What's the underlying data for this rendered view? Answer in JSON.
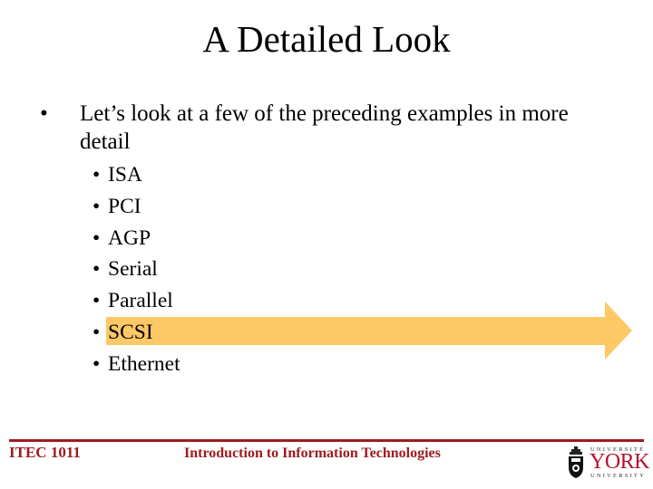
{
  "slide": {
    "title": "A Detailed Look",
    "main_bullet": {
      "glyph": "•",
      "text": "Let’s look at a few of the preceding examples in more detail"
    },
    "sub_bullets": [
      {
        "glyph": "•",
        "text": "ISA"
      },
      {
        "glyph": "•",
        "text": "PCI"
      },
      {
        "glyph": "•",
        "text": "AGP"
      },
      {
        "glyph": "•",
        "text": "Serial"
      },
      {
        "glyph": "•",
        "text": "Parallel"
      },
      {
        "glyph": "•",
        "text": "SCSI",
        "highlighted": true
      },
      {
        "glyph": "•",
        "text": "Ethernet"
      }
    ],
    "highlight_arrow": {
      "icon": "right-arrow-icon",
      "color": "#FDC866",
      "points_to": "SCSI"
    }
  },
  "footer": {
    "course_code": "ITEC 1011",
    "course_title": "Introduction to Information Technologies",
    "rule_color": "#9E1B20",
    "text_color": "#9E1B20",
    "logo": {
      "icon": "york-crest-icon",
      "top_text": "UNIVERSITÉ",
      "name": "YORK",
      "bottom_text": "UNIVERSITY",
      "name_color": "#B5122F"
    }
  }
}
